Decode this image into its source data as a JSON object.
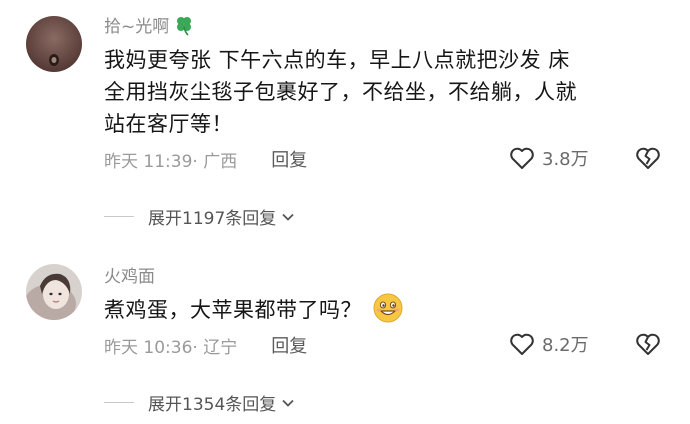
{
  "comments": [
    {
      "username": "拾~光啊",
      "username_icon": "four-leaf-clover-icon",
      "text_lines": [
        "我妈更夸张 下午六点的车，早上八点就把沙发 床",
        "全用挡灰尘毯子包裹好了，不给坐，不给躺，人就",
        "站在客厅等！"
      ],
      "time": "昨天 11:39",
      "location": "· 广西",
      "reply_label": "回复",
      "likes": "3.8万",
      "expand_label": "展开1197条回复"
    },
    {
      "username": "火鸡面",
      "text": "煮鸡蛋，大苹果都带了吗？",
      "text_emoji": "grinning-face-emoji",
      "time": "昨天 10:36",
      "location": "· 辽宁",
      "reply_label": "回复",
      "likes": "8.2万",
      "expand_label": "展开1354条回复"
    }
  ],
  "colors": {
    "meta_gray": "#9a9a9a",
    "username_gray": "#8b8b8b",
    "clover_green": "#3aa857",
    "emoji_yellow": "#f7c744"
  }
}
